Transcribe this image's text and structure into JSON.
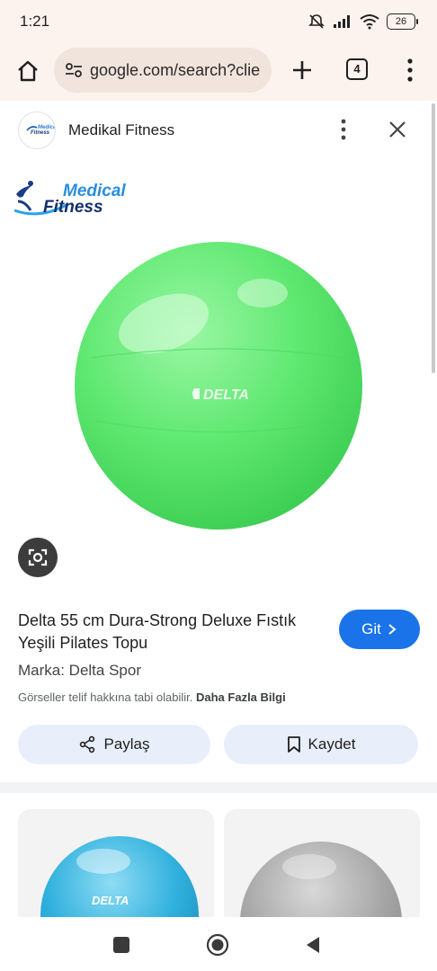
{
  "status": {
    "time": "1:21",
    "battery": "26"
  },
  "browser": {
    "url": "google.com/search?clie",
    "tab_count": "4"
  },
  "source": {
    "name": "Medikal Fitness",
    "logo_text_top": "Medical",
    "logo_text_bottom": "Fitness"
  },
  "image": {
    "ball_color": "#6fef7f",
    "ball_brand": "DELTA"
  },
  "product": {
    "title": "Delta 55 cm Dura-Strong Deluxe Fıstık Yeşili Pilates Topu",
    "brand_line": "Marka: Delta Spor",
    "copyright_text": "Görseller telif hakkına tabi olabilir.",
    "more_info": "Daha Fazla Bilgi",
    "go_label": "Git"
  },
  "actions": {
    "share_label": "Paylaş",
    "save_label": "Kaydet"
  },
  "related": [
    {
      "color": "#29a9d6",
      "brand": "DELTA"
    },
    {
      "color": "#9e9e9e",
      "brand": ""
    }
  ],
  "colors": {
    "accent": "#1a73e8",
    "toolbar_bg": "#fdf3ee",
    "action_bg": "#e8effb"
  }
}
